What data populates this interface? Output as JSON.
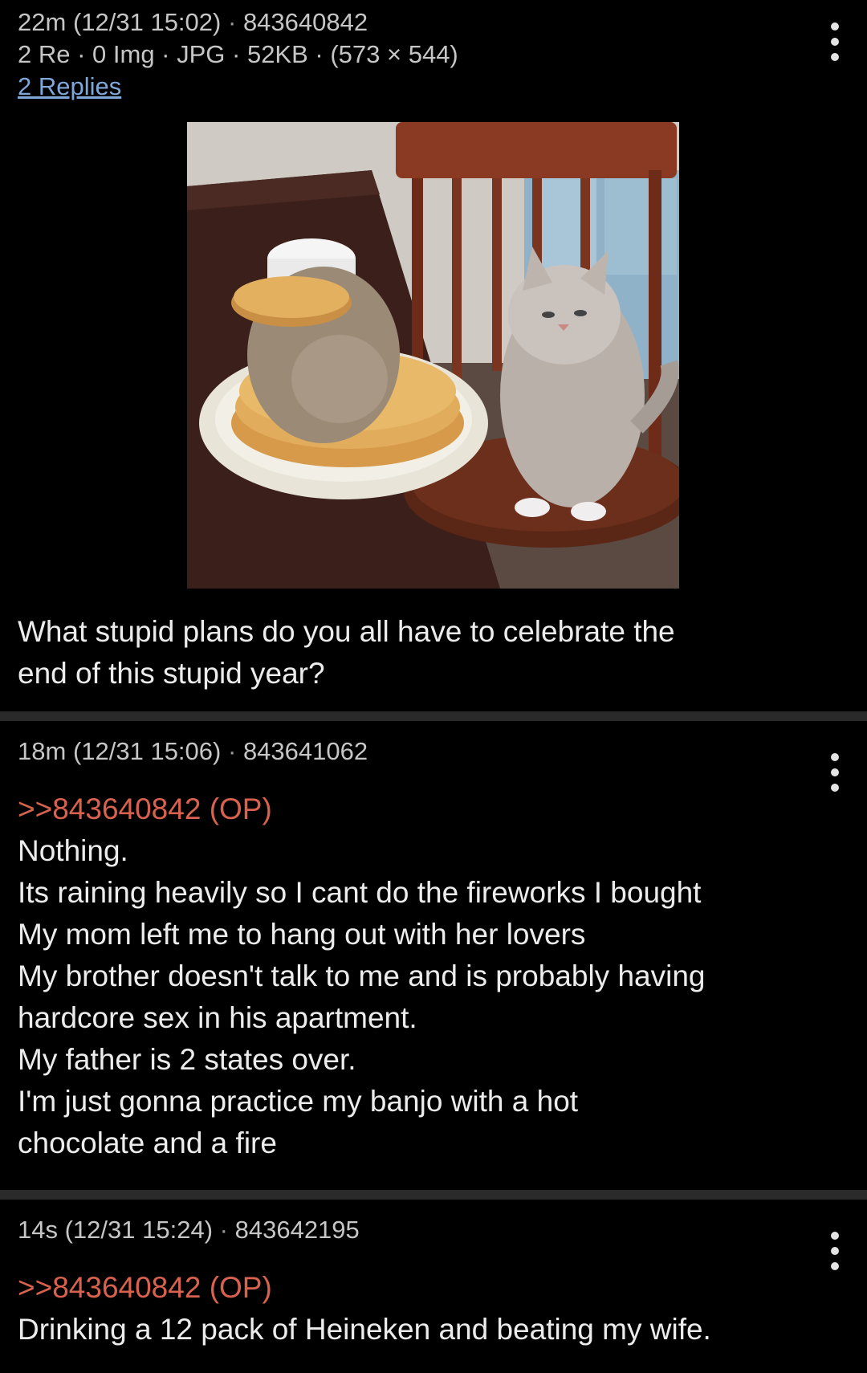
{
  "posts": [
    {
      "age": "22m",
      "datetime": "(12/31 15:02)",
      "post_id": "843640842",
      "file_info": "2 Re · 0 Img · JPG · 52KB · (573 × 544)",
      "replies_link": "2 Replies",
      "body": "What stupid plans do you all have to celebrate the\nend of this stupid year?"
    },
    {
      "age": "18m",
      "datetime": "(12/31 15:06)",
      "post_id": "843641062",
      "quote": ">>843640842 (OP)",
      "body": "Nothing.\nIts raining heavily so I cant do the fireworks I bought\nMy mom left me to hang out with her lovers\nMy brother doesn't talk to me and is probably having\nhardcore sex in his apartment.\nMy father is 2 states over.\nI'm just gonna practice my banjo with a hot\nchocolate and a fire"
    },
    {
      "age": "14s",
      "datetime": "(12/31 15:24)",
      "post_id": "843642195",
      "quote": ">>843640842 (OP)",
      "body": "Drinking a 12 pack of Heineken and beating my wife."
    }
  ],
  "separator": "·",
  "icons": {
    "menu": "vertical-dots-icon"
  },
  "colors": {
    "background": "#000000",
    "quote": "#d9624f",
    "link": "#7fa8d8",
    "divider": "#2a2a2a"
  }
}
